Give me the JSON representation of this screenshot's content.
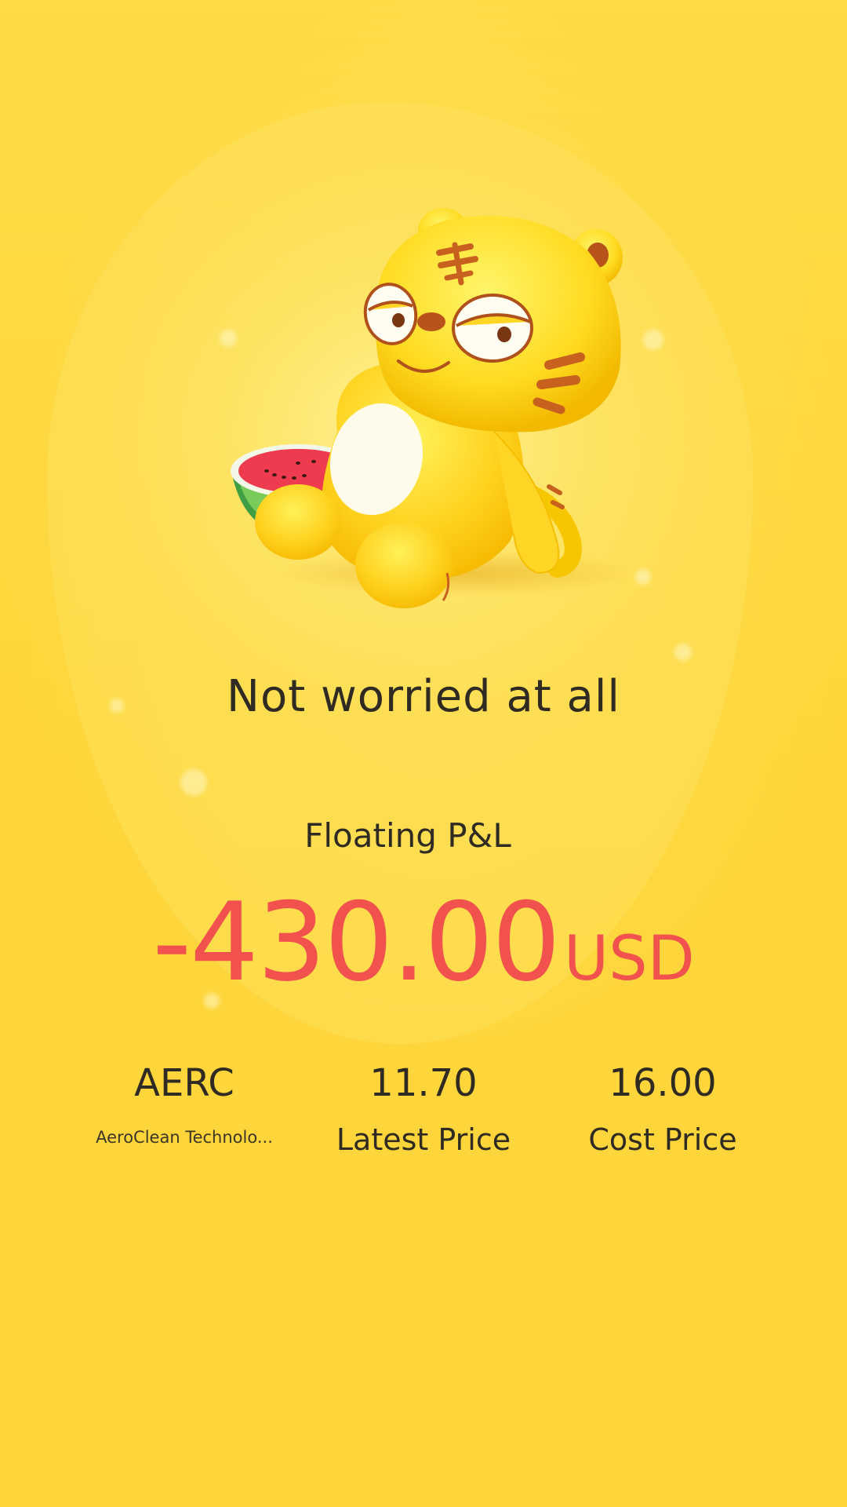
{
  "message": "Not worried at all",
  "pnl": {
    "label": "Floating P&L",
    "amount": "-430.00",
    "currency": "USD",
    "color": "#F2524E"
  },
  "stock": {
    "symbol": "AERC",
    "name": "AeroClean Technolo..."
  },
  "latest_price": {
    "value": "11.70",
    "label": "Latest Price"
  },
  "cost_price": {
    "value": "16.00",
    "label": "Cost Price"
  },
  "colors": {
    "background": "#FED63A",
    "text": "#2f2b22",
    "loss": "#F2524E"
  },
  "illustration": "tiger-mascot-with-watermelon"
}
